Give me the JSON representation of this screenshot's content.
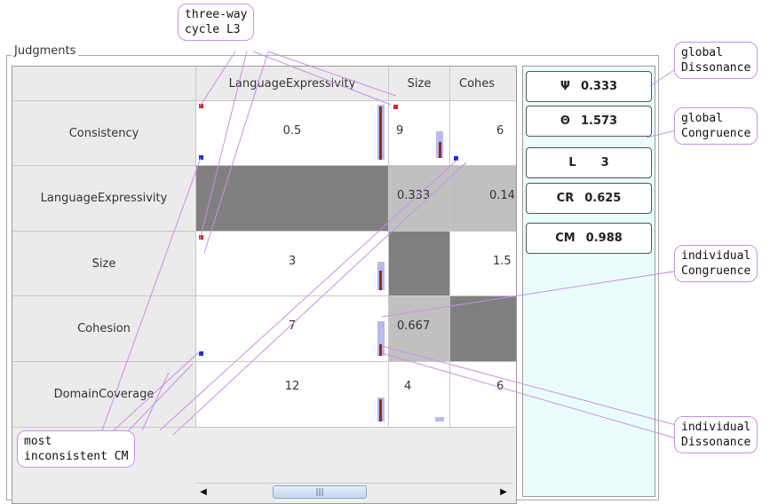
{
  "group_title": "Judgments",
  "columns": [
    "LanguageExpressivity",
    "Size",
    "Cohes"
  ],
  "rows": [
    {
      "label": "Consistency",
      "values": [
        "0.5",
        "9",
        "6"
      ]
    },
    {
      "label": "LanguageExpressivity",
      "values": [
        "",
        "0.333",
        "0.14"
      ]
    },
    {
      "label": "Size",
      "values": [
        "3",
        "",
        "1.5"
      ]
    },
    {
      "label": "Cohesion",
      "values": [
        "7",
        "0.667",
        ""
      ]
    },
    {
      "label": "DomainCoverage",
      "values": [
        "12",
        "4",
        "6"
      ]
    }
  ],
  "metrics": [
    {
      "symbol": "Ψ",
      "value": "0.333"
    },
    {
      "symbol": "Θ",
      "value": "1.573"
    },
    {
      "symbol": "L",
      "value": "3"
    },
    {
      "symbol": "CR",
      "value": "0.625"
    },
    {
      "symbol": "CM",
      "value": "0.988"
    }
  ],
  "callouts": {
    "three_way_cycle": "three-way\ncycle L3",
    "global_dissonance": "global\nDissonance",
    "global_congruence": "global\nCongruence",
    "individual_congruence": "individual\nCongruence",
    "individual_dissonance": "individual\nDissonance",
    "most_inconsistent": "most\ninconsistent CM"
  },
  "scrollbar": {
    "left_arrow": "◀",
    "right_arrow": "▶",
    "thumb_grip": "|||"
  },
  "colors": {
    "dissonance_bar": "#8b2b2b",
    "congruence_bar": "#b9b9ec",
    "red_marker": "#e02020",
    "blue_marker": "#1c2fd8",
    "panel_bg": "#eafdfd",
    "callout_border": "#c990e6"
  }
}
